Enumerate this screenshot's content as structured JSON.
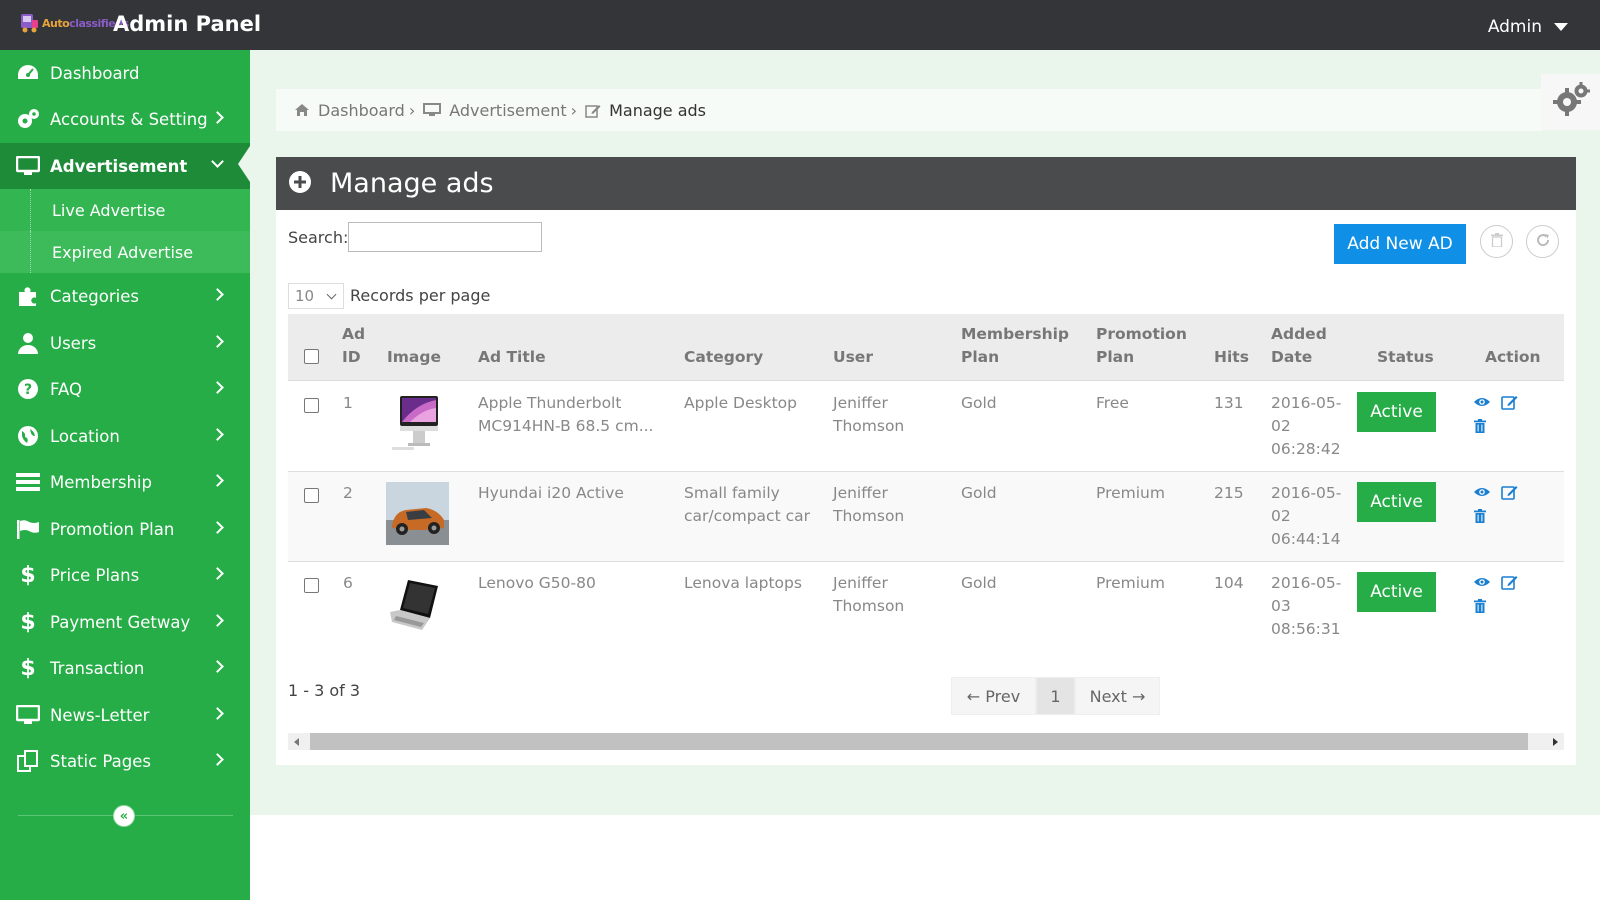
{
  "header": {
    "logo_text_a": "Auto",
    "logo_text_b": "classifieds",
    "title": "Admin Panel",
    "user_menu": "Admin"
  },
  "sidebar": {
    "items": [
      {
        "label": "Dashboard",
        "icon": "dashboard-icon"
      },
      {
        "label": "Accounts & Setting",
        "icon": "gears-icon"
      },
      {
        "label": "Advertisement",
        "icon": "desktop-icon",
        "active": true,
        "children": [
          {
            "label": "Live Advertise"
          },
          {
            "label": "Expired Advertise"
          }
        ]
      },
      {
        "label": "Categories",
        "icon": "puzzle-icon"
      },
      {
        "label": "Users",
        "icon": "user-icon"
      },
      {
        "label": "FAQ",
        "icon": "question-icon"
      },
      {
        "label": "Location",
        "icon": "globe-icon"
      },
      {
        "label": "Membership",
        "icon": "list-icon"
      },
      {
        "label": "Promotion Plan",
        "icon": "flag-icon"
      },
      {
        "label": "Price Plans",
        "icon": "dollar-icon"
      },
      {
        "label": "Payment Getway",
        "icon": "dollar-icon"
      },
      {
        "label": "Transaction",
        "icon": "dollar-icon"
      },
      {
        "label": "News-Letter",
        "icon": "desktop-icon"
      },
      {
        "label": "Static Pages",
        "icon": "copy-icon"
      }
    ],
    "collapse_glyph": "«"
  },
  "breadcrumb": {
    "items": [
      "Dashboard",
      "Advertisement"
    ],
    "separator": "›",
    "current": "Manage ads"
  },
  "panel": {
    "title": "Manage ads",
    "search_label": "Search:",
    "search_value": "",
    "add_button": "Add New AD",
    "per_page_value": "10",
    "per_page_label": "Records per page"
  },
  "table": {
    "headers": {
      "ad_id": [
        "Ad",
        "ID"
      ],
      "image": "Image",
      "ad_title": "Ad Title",
      "category": "Category",
      "user": "User",
      "membership_plan": [
        "Membership",
        "Plan"
      ],
      "promotion_plan": [
        "Promotion",
        "Plan"
      ],
      "hits": "Hits",
      "added_date": [
        "Added",
        "Date"
      ],
      "status": "Status",
      "action": "Action"
    },
    "rows": [
      {
        "id": "1",
        "image": "imac-thumbnail",
        "title": [
          "Apple Thunderbolt",
          "MC914HN-B 68.5 cm..."
        ],
        "category": [
          "Apple Desktop"
        ],
        "user": [
          "Jeniffer",
          "Thomson"
        ],
        "membership": "Gold",
        "promotion": "Free",
        "hits": "131",
        "date": [
          "2016-05-",
          "02",
          "06:28:42"
        ],
        "status": "Active"
      },
      {
        "id": "2",
        "image": "car-thumbnail",
        "title": [
          "Hyundai i20 Active"
        ],
        "category": [
          "Small family",
          "car/compact car"
        ],
        "user": [
          "Jeniffer",
          "Thomson"
        ],
        "membership": "Gold",
        "promotion": "Premium",
        "hits": "215",
        "date": [
          "2016-05-",
          "02",
          "06:44:14"
        ],
        "status": "Active"
      },
      {
        "id": "6",
        "image": "laptop-thumbnail",
        "title": [
          "Lenovo G50-80"
        ],
        "category": [
          "Lenova laptops"
        ],
        "user": [
          "Jeniffer",
          "Thomson"
        ],
        "membership": "Gold",
        "promotion": "Premium",
        "hits": "104",
        "date": [
          "2016-05-",
          "03",
          "08:56:31"
        ],
        "status": "Active"
      }
    ]
  },
  "pagination": {
    "info": "1 - 3 of 3",
    "prev": "← Prev",
    "current": "1",
    "next": "Next →"
  },
  "colors": {
    "sidebar": "#26ad47",
    "topbar": "#333538",
    "primary_button": "#0f8fe6",
    "status_active": "#26ad47",
    "action_icon": "#1a7fd0"
  }
}
